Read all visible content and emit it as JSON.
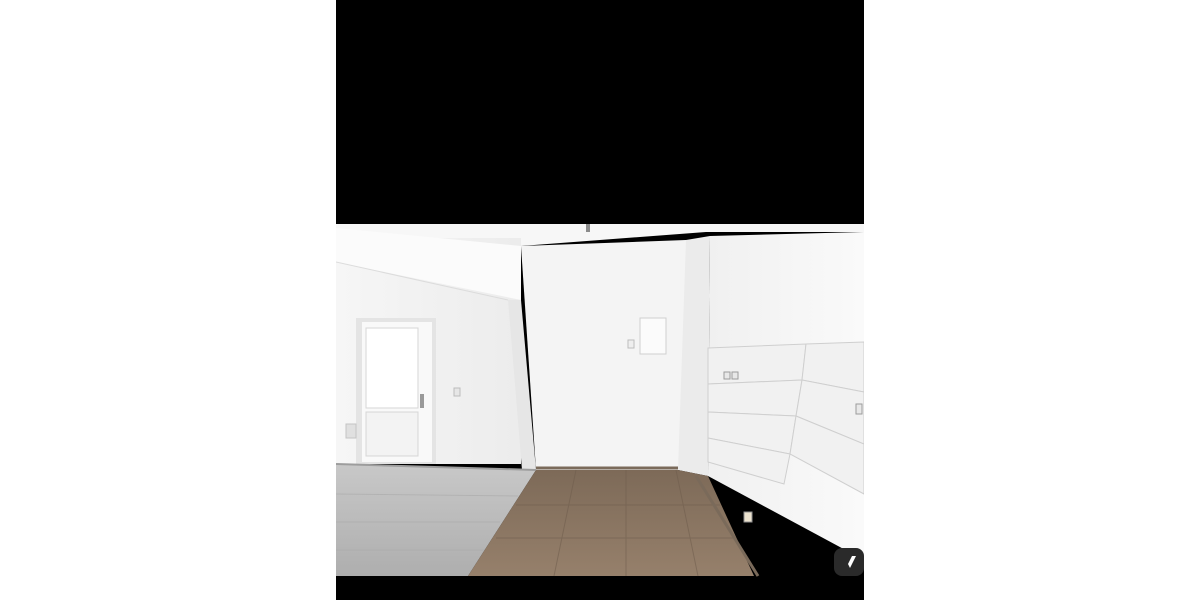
{
  "image": {
    "subject": "empty-room-interior",
    "colors": {
      "background": "#ffffff",
      "letterbox": "#000000",
      "wall": "#f2f2f2",
      "floor_wood": "#8a7562",
      "floor_gray": "#b9b9b9",
      "tile": "#ededed"
    },
    "icons": [
      "corner-action-icon"
    ]
  }
}
